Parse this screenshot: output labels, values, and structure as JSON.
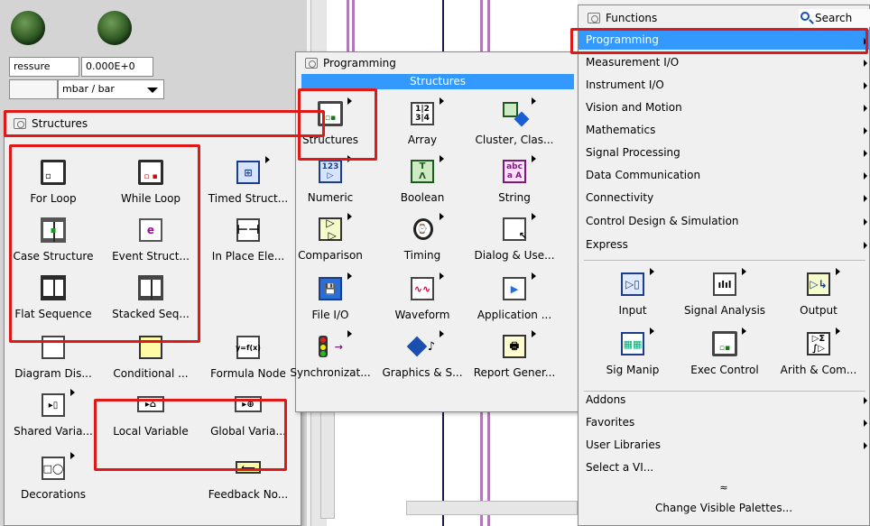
{
  "front_panel": {
    "pressure_label": "ressure",
    "pressure_value": "0.000E+0",
    "unit_select": "mbar / bar"
  },
  "structures_palette": {
    "title": "Structures",
    "items": [
      {
        "label": "For Loop",
        "icon": "for-loop-icon"
      },
      {
        "label": "While Loop",
        "icon": "while-loop-icon"
      },
      {
        "label": "Timed Struct...",
        "icon": "timed-structure-icon"
      },
      {
        "label": "Case Structure",
        "icon": "case-structure-icon"
      },
      {
        "label": "Event Struct...",
        "icon": "event-structure-icon"
      },
      {
        "label": "In Place Ele...",
        "icon": "in-place-element-icon"
      },
      {
        "label": "Flat Sequence",
        "icon": "flat-sequence-icon"
      },
      {
        "label": "Stacked Seq...",
        "icon": "stacked-sequence-icon"
      },
      {
        "label": "Diagram Dis...",
        "icon": "diagram-disable-icon"
      },
      {
        "label": "Conditional ...",
        "icon": "conditional-disable-icon"
      },
      {
        "label": "Formula Node",
        "icon": "formula-node-icon"
      },
      {
        "label": "Shared Varia...",
        "icon": "shared-variable-icon"
      },
      {
        "label": "Local Variable",
        "icon": "local-variable-icon"
      },
      {
        "label": "Global Varia...",
        "icon": "global-variable-icon"
      },
      {
        "label": "Decorations",
        "icon": "decorations-icon"
      },
      {
        "label": "Feedback No...",
        "icon": "feedback-node-icon"
      }
    ]
  },
  "programming_palette": {
    "title": "Programming",
    "section": "Structures",
    "items": [
      {
        "label": "Structures",
        "icon": "structures-icon"
      },
      {
        "label": "Array",
        "icon": "array-icon"
      },
      {
        "label": "Cluster, Clas...",
        "icon": "cluster-icon"
      },
      {
        "label": "Numeric",
        "icon": "numeric-icon"
      },
      {
        "label": "Boolean",
        "icon": "boolean-icon"
      },
      {
        "label": "String",
        "icon": "string-icon"
      },
      {
        "label": "Comparison",
        "icon": "comparison-icon"
      },
      {
        "label": "Timing",
        "icon": "timing-icon"
      },
      {
        "label": "Dialog & Use...",
        "icon": "dialog-icon"
      },
      {
        "label": "File I/O",
        "icon": "file-io-icon"
      },
      {
        "label": "Waveform",
        "icon": "waveform-icon"
      },
      {
        "label": "Application ...",
        "icon": "application-control-icon"
      },
      {
        "label": "Synchronizat...",
        "icon": "synchronization-icon"
      },
      {
        "label": "Graphics & S...",
        "icon": "graphics-sound-icon"
      },
      {
        "label": "Report Gener...",
        "icon": "report-generation-icon"
      }
    ]
  },
  "functions_palette": {
    "title": "Functions",
    "search_label": "Search",
    "categories": [
      "Programming",
      "Measurement I/O",
      "Instrument I/O",
      "Vision and Motion",
      "Mathematics",
      "Signal Processing",
      "Data Communication",
      "Connectivity",
      "Control Design & Simulation",
      "Express"
    ],
    "express_items": [
      {
        "label": "Input",
        "icon": "input-icon"
      },
      {
        "label": "Signal Analysis",
        "icon": "signal-analysis-icon"
      },
      {
        "label": "Output",
        "icon": "output-icon"
      },
      {
        "label": "Sig Manip",
        "icon": "sig-manip-icon"
      },
      {
        "label": "Exec Control",
        "icon": "exec-control-icon"
      },
      {
        "label": "Arith & Com...",
        "icon": "arith-comparison-icon"
      }
    ],
    "more_categories": [
      "Addons",
      "Favorites",
      "User Libraries",
      "Select a VI..."
    ],
    "change_palettes": "Change Visible Palettes...",
    "expand_glyph": "≈"
  },
  "colors": {
    "selection": "#3399ff",
    "highlight": "#e01818",
    "led": "#2e5a22"
  }
}
